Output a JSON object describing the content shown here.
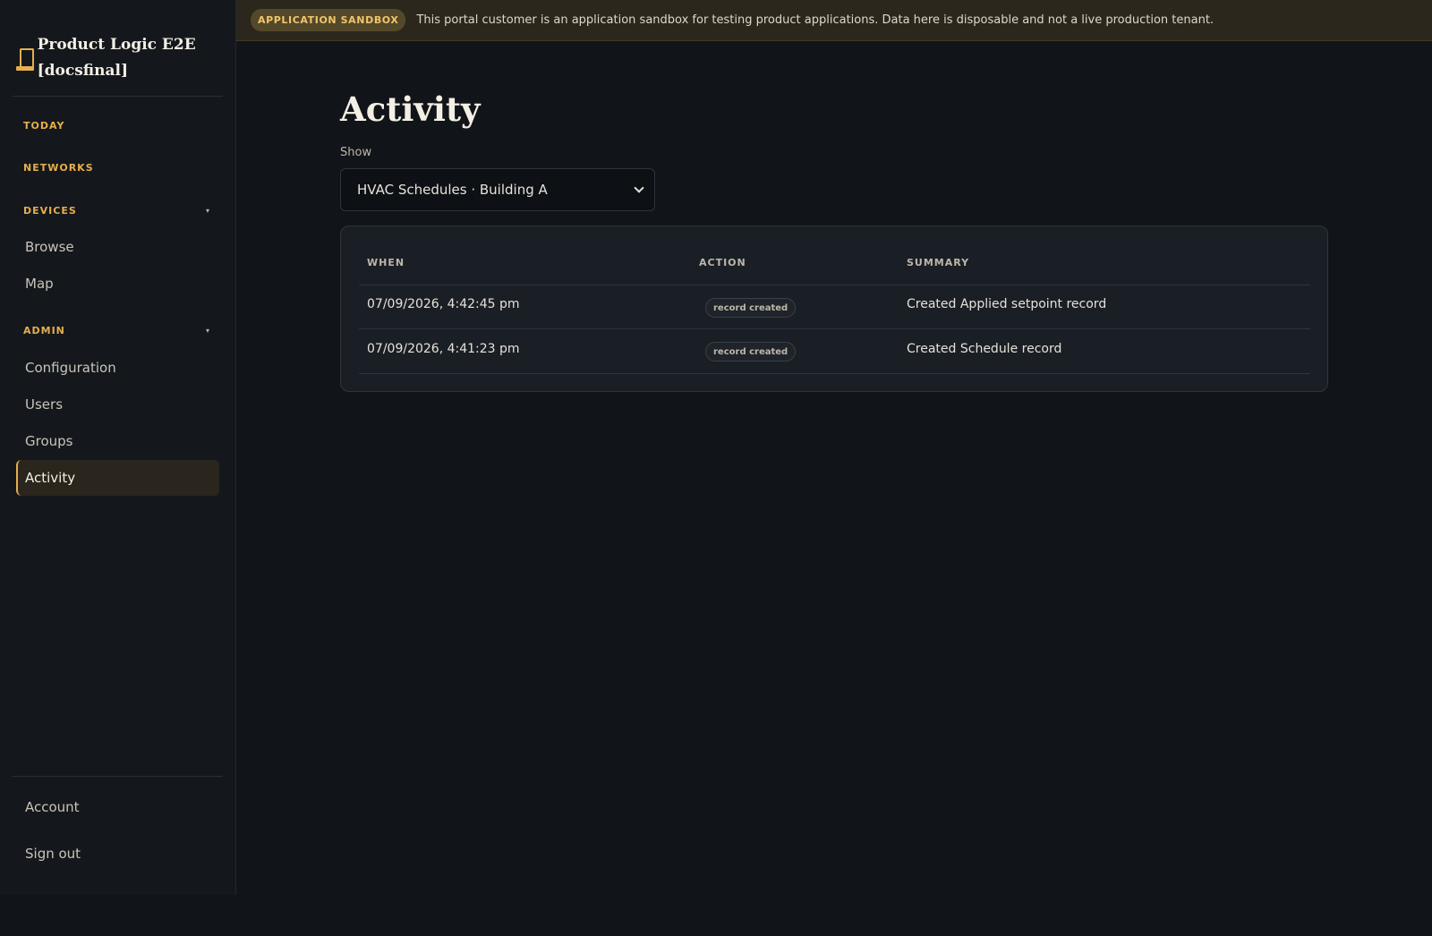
{
  "sidebar": {
    "brand_title": "Product Logic E2E [docsfinal]",
    "sections": {
      "today": "TODAY",
      "networks": "NETWORKS",
      "devices": "DEVICES",
      "admin": "ADMIN"
    },
    "caret_glyph": "▾",
    "items": {
      "browse": "Browse",
      "map": "Map",
      "configuration": "Configuration",
      "users": "Users",
      "groups": "Groups",
      "activity": "Activity",
      "account": "Account",
      "sign_out": "Sign out"
    },
    "active_item": "Activity"
  },
  "banner": {
    "badge": "APPLICATION SANDBOX",
    "text": "This portal customer is an application sandbox for testing product applications. Data here is disposable and not a live production tenant."
  },
  "main": {
    "title": "Activity",
    "filter": {
      "label": "Show",
      "selected": "HVAC Schedules · Building A"
    },
    "table": {
      "columns": [
        "WHEN",
        "ACTION",
        "SUMMARY"
      ],
      "rows": [
        {
          "when": "07/09/2026, 4:42:45 pm",
          "action": "record created",
          "summary": "Created Applied setpoint record"
        },
        {
          "when": "07/09/2026, 4:41:23 pm",
          "action": "record created",
          "summary": "Created Schedule record"
        }
      ]
    }
  },
  "colors": {
    "accent": "#e6ae4c",
    "background": "#111418",
    "sidebar": "#14181d",
    "banner": "#2b271c",
    "card": "#1a1f25"
  }
}
